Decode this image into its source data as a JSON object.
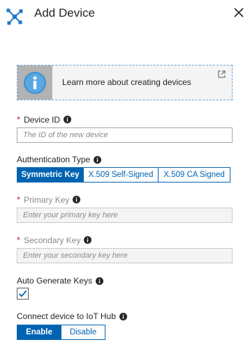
{
  "header": {
    "title": "Add Device",
    "logo_icon": "iot-hub-icon",
    "close_icon": "close-icon"
  },
  "info_banner": {
    "text": "Learn more about creating devices",
    "icon": "info-icon",
    "link_icon": "external-link-icon"
  },
  "device_id": {
    "label": "Device ID",
    "required_mark": "*",
    "placeholder": "The ID of the new device"
  },
  "auth_type": {
    "label": "Authentication Type",
    "options": [
      "Symmetric Key",
      "X.509 Self-Signed",
      "X.509 CA Signed"
    ],
    "selected": "Symmetric Key"
  },
  "primary_key": {
    "label": "Primary Key",
    "required_mark": "*",
    "placeholder": "Enter your primary key here"
  },
  "secondary_key": {
    "label": "Secondary Key",
    "required_mark": "*",
    "placeholder": "Enter your secondary key here"
  },
  "auto_generate": {
    "label": "Auto Generate Keys",
    "checked": true
  },
  "connect": {
    "label": "Connect device to IoT Hub",
    "options": [
      "Enable",
      "Disable"
    ],
    "selected": "Enable"
  },
  "colors": {
    "accent": "#0063b1",
    "required": "#c1272d",
    "banner_border": "#6aa3d6",
    "logo": "#1e74c6"
  }
}
